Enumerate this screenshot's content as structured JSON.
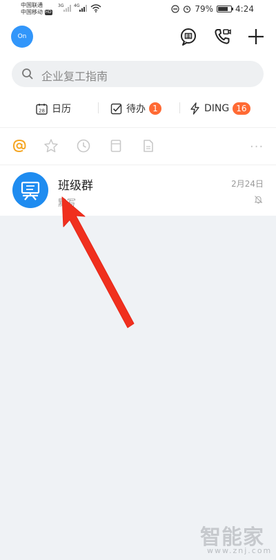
{
  "status_bar": {
    "carrier_1": "中国联通",
    "carrier_2": "中国移动",
    "hd": "HD",
    "net_1": "3G",
    "net_2": "4G",
    "battery": "79%",
    "battery_level": 0.79,
    "time": "4:24"
  },
  "header": {
    "avatar_text": "On",
    "icons": [
      "secret-chat-icon",
      "video-call-icon",
      "plus-icon"
    ]
  },
  "search": {
    "placeholder": "企业复工指南"
  },
  "quick_actions": [
    {
      "icon": "calendar-icon",
      "calendar_day": "28",
      "label": "日历"
    },
    {
      "icon": "todo-check-icon",
      "label": "待办",
      "badge": "1"
    },
    {
      "icon": "lightning-icon",
      "label": "DING",
      "badge": "16"
    }
  ],
  "filters": {
    "icons": [
      "at-icon",
      "star-icon",
      "clock-icon",
      "bookmark-icon",
      "document-icon"
    ],
    "active": "at-icon",
    "more": "···"
  },
  "chats": [
    {
      "name": "班级群",
      "preview": "默写",
      "date": "2月24日",
      "muted": true
    }
  ],
  "watermark": {
    "text": "智能家",
    "url": "www.znj.com"
  },
  "colors": {
    "accent": "#3296fa",
    "badge": "#ff6a34",
    "at_active": "#f5a623",
    "arrow": "#f0301e"
  }
}
